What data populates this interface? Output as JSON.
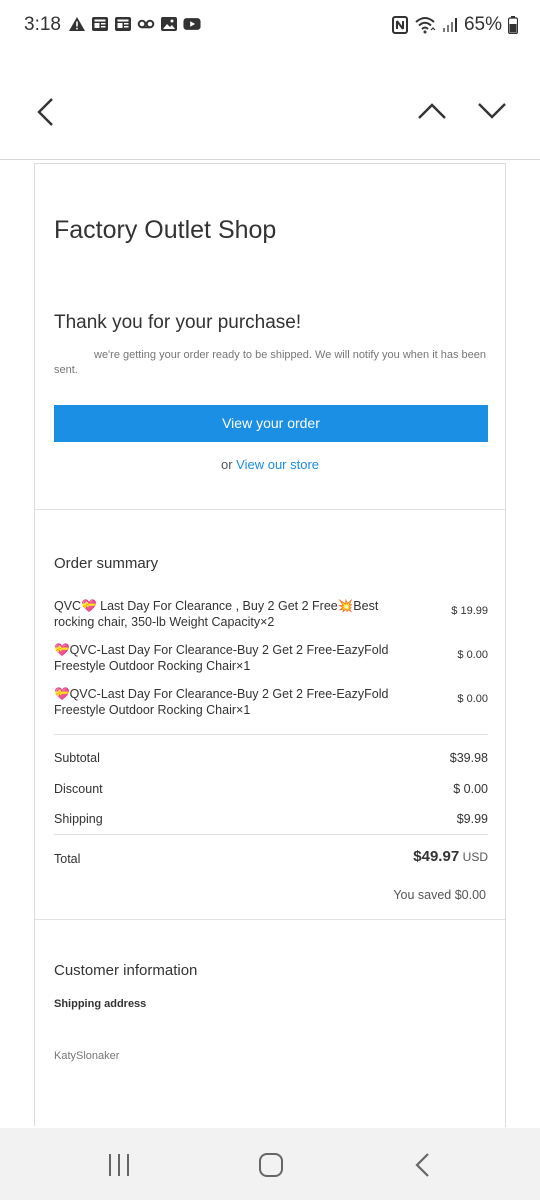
{
  "status_bar": {
    "time": "3:18",
    "battery": "65%",
    "left_icons": [
      "warning-icon",
      "news-icon",
      "news-icon",
      "voicemail-icon",
      "image-icon",
      "youtube-icon"
    ],
    "right_icons": [
      "nfc-icon",
      "wifi-icon",
      "signal-icon",
      "battery-icon"
    ]
  },
  "header": {
    "back": "chevron-left-icon",
    "prev": "chevron-up-icon",
    "next": "chevron-down-icon"
  },
  "email": {
    "shop_name": "Factory Outlet Shop",
    "thanks": "Thank you for your purchase!",
    "notice": "we're getting your order ready to be shipped. We will notify you when it has been sent.",
    "view_order_label": "View your order",
    "or_text": "or",
    "store_link": "View our store",
    "order_summary_title": "Order summary",
    "items": [
      {
        "name": "QVC💝 Last Day For Clearance , Buy 2 Get 2 Free💥Best rocking chair, 350-lb Weight Capacity×2",
        "price": "$ 19.99"
      },
      {
        "name": "💝QVC-Last Day For Clearance-Buy 2 Get 2 Free-EazyFold Freestyle Outdoor Rocking Chair×1",
        "price": "$ 0.00"
      },
      {
        "name": "💝QVC-Last Day For Clearance-Buy 2 Get 2 Free-EazyFold Freestyle Outdoor Rocking Chair×1",
        "price": "$ 0.00"
      }
    ],
    "subtotal_label": "Subtotal",
    "subtotal_value": "$39.98",
    "discount_label": "Discount",
    "discount_value": "$ 0.00",
    "shipping_label": "Shipping",
    "shipping_value": "$9.99",
    "total_label": "Total",
    "total_value": "$49.97",
    "total_currency": "USD",
    "saved_text": "You saved $0.00",
    "customer_info_title": "Customer information",
    "shipping_address_label": "Shipping address",
    "customer_name": "KatySlonaker"
  },
  "nav": {
    "recent": "recent-apps-icon",
    "home": "home-icon",
    "back": "back-icon"
  },
  "colors": {
    "accent": "#1a8fe3"
  }
}
